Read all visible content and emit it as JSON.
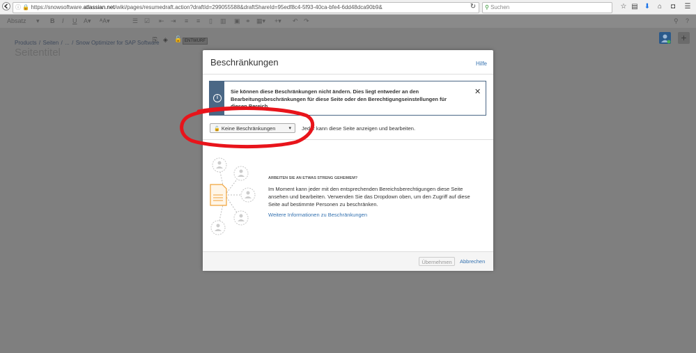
{
  "browser": {
    "url_prefix": "https://snowsoftware.",
    "url_host": "atlassian.net",
    "url_path": "/wiki/pages/resumedraft.action?draftId=299055588&draftShareId=95edf8c4-5f93-40ca-bfe4-6dd48dca90b9&",
    "search_placeholder": "Suchen"
  },
  "editor_toolbar": {
    "paragraph_label": "Absatz",
    "bold": "B",
    "italic": "I",
    "underline": "U"
  },
  "breadcrumb": {
    "items": [
      "Products",
      "Seiten",
      "...",
      "Snow Optimizer for SAP Software"
    ],
    "separator": "/",
    "draft_badge": "ENTWURF"
  },
  "page": {
    "title": "Seitentitel"
  },
  "dialog": {
    "title": "Beschränkungen",
    "help_link": "Hilfe",
    "info_message": "Sie können diese Beschränkungen nicht ändern. Dies liegt entweder an den Bearbeitungsbeschränkungen für diese Seite oder den Berechtigungseinstellungen für diesen Bereich.",
    "restriction_select_value": "Keine Beschränkungen",
    "restriction_description": "Jeder kann diese Seite anzeigen und bearbeiten.",
    "promo_heading": "ARBEITEN SIE AN ETWAS STRENG GEHEIMEM?",
    "promo_body": "Im Moment kann jeder mit den entsprechenden Bereichsberechtigungen diese Seite ansehen und bearbeiten. Verwenden Sie das Dropdown oben, um den Zugriff auf diese Seite auf bestimmte Personen zu beschränken.",
    "promo_link": "Weitere Informationen zu Beschränkungen",
    "apply_button": "Übernehmen",
    "cancel_button": "Abbrechen"
  },
  "colors": {
    "overlay": "#7f7f7f",
    "link": "#3572b0",
    "info_bar": "#4a6785",
    "annotation": "#e8141b",
    "illustration_accent": "#f0a33a"
  },
  "icons": [
    "back-icon",
    "info-icon",
    "lock-icon",
    "reload-icon",
    "search-icon",
    "star-icon",
    "download-icon",
    "home-icon",
    "menu-icon",
    "close-icon",
    "chevron-down-icon",
    "document-icon",
    "user-icon"
  ]
}
